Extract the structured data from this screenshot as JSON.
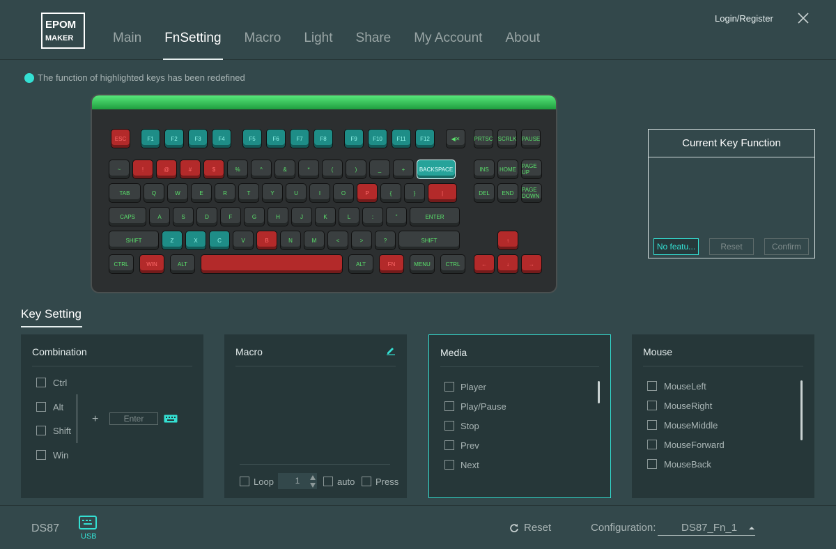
{
  "brand": {
    "logo_text": "EPOMAKER"
  },
  "nav": {
    "tabs": [
      {
        "label": "Main"
      },
      {
        "label": "FnSetting"
      },
      {
        "label": "Macro"
      },
      {
        "label": "Light"
      },
      {
        "label": "Share"
      },
      {
        "label": "My Account"
      },
      {
        "label": "About"
      }
    ],
    "active": "FnSetting"
  },
  "header": {
    "login": "Login/Register"
  },
  "notice": "The function of highlighted keys has been redefined",
  "keyboard": {
    "frow": [
      "ESC",
      "F1",
      "F2",
      "F3",
      "F4",
      "F5",
      "F6",
      "F7",
      "F8",
      "F9",
      "F10",
      "F11",
      "F12",
      "◀✕",
      "PRTSC",
      "SCRLK",
      "PAUSE"
    ],
    "rows": [
      [
        "~",
        "!",
        "@",
        "#",
        "$",
        "%",
        "^",
        "&",
        "*",
        "(",
        ")",
        "_",
        "+",
        "BACKSPACE"
      ],
      [
        "TAB",
        "Q",
        "W",
        "E",
        "R",
        "T",
        "Y",
        "U",
        "I",
        "O",
        "P",
        "{",
        "}",
        "|"
      ],
      [
        "CAPS",
        "A",
        "S",
        "D",
        "F",
        "G",
        "H",
        "J",
        "K",
        "L",
        ":",
        "\"",
        "ENTER"
      ],
      [
        "SHIFT",
        "Z",
        "X",
        "C",
        "V",
        "B",
        "N",
        "M",
        "<",
        ">",
        "?",
        "SHIFT"
      ],
      [
        "CTRL",
        "WIN",
        "ALT",
        "",
        "ALT",
        "FN",
        "MENU",
        "CTRL"
      ]
    ],
    "nav": [
      "INS",
      "HOME",
      "PAGE UP",
      "DEL",
      "END",
      "PAGE DOWN"
    ],
    "arrows": [
      "↑",
      "←",
      "↓",
      "→"
    ]
  },
  "current_key": {
    "title": "Current Key Function",
    "value_button": "No featu...",
    "reset": "Reset",
    "confirm": "Confirm"
  },
  "key_setting": {
    "title": "Key Setting"
  },
  "combination": {
    "title": "Combination",
    "options": [
      "Ctrl",
      "Alt",
      "Shift",
      "Win"
    ],
    "plus": "+",
    "key_placeholder": "Enter"
  },
  "macro": {
    "title": "Macro",
    "loop": "Loop",
    "count": "1",
    "auto": "auto",
    "press": "Press"
  },
  "media": {
    "title": "Media",
    "items": [
      "Player",
      "Play/Pause",
      "Stop",
      "Prev",
      "Next"
    ]
  },
  "mouse": {
    "title": "Mouse",
    "items": [
      "MouseLeft",
      "MouseRight",
      "MouseMiddle",
      "MouseForward",
      "MouseBack"
    ]
  },
  "footer": {
    "device": "DS87",
    "connection": "USB",
    "reset": "Reset",
    "config_label": "Configuration:",
    "config_value": "DS87_Fn_1"
  },
  "colors": {
    "accent": "#34e0d3",
    "bg": "#33484b",
    "panel": "#263739",
    "key_red": "#b32a2a",
    "key_teal": "#1e8d87"
  }
}
